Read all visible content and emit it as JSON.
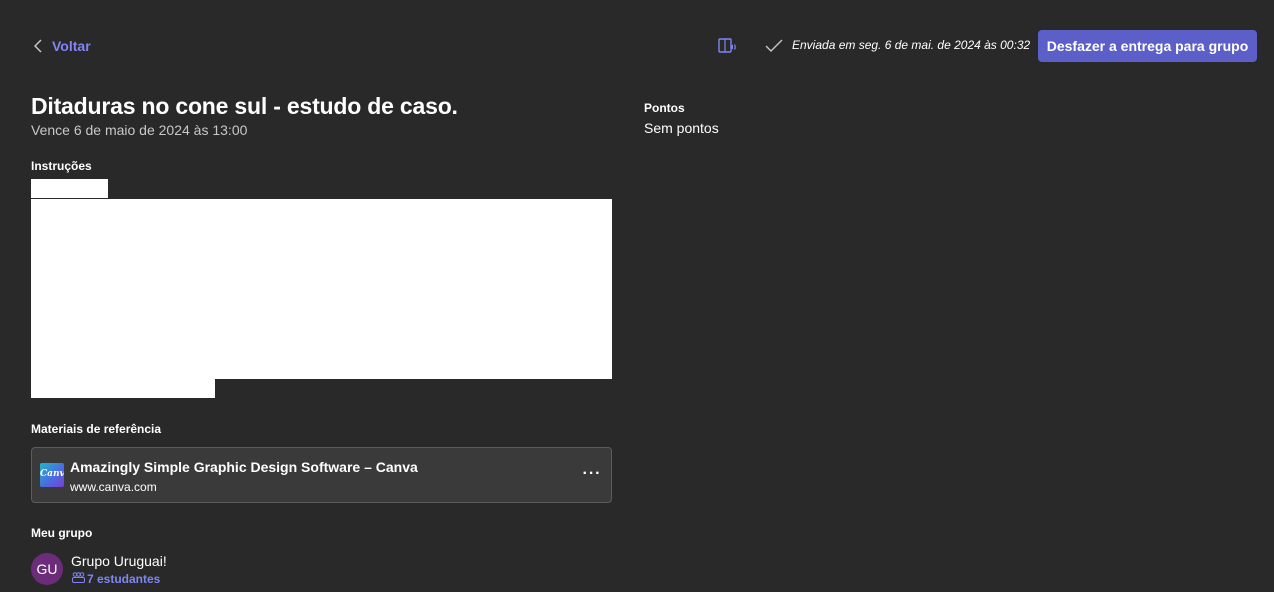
{
  "header": {
    "back_label": "Voltar",
    "sent_status": "Enviada em seg. 6 de mai. de 2024 às 00:32",
    "undo_button_label": "Desfazer a entrega para grupo",
    "icons": {
      "back": "chevron-left-icon",
      "reader": "immersive-reader-icon",
      "sent": "checkmark-icon"
    }
  },
  "assignment": {
    "title": "Ditaduras no cone sul - estudo de caso.",
    "due": "Vence 6 de maio de 2024 às 13:00"
  },
  "instructions": {
    "label": "Instruções"
  },
  "reference": {
    "label": "Materiais de referência",
    "items": [
      {
        "title": "Amazingly Simple Graphic Design Software – Canva",
        "url": "www.canva.com",
        "thumb_text": "Canva",
        "more_label": "···"
      }
    ]
  },
  "group": {
    "label": "Meu grupo",
    "avatar_initials": "GU",
    "name": "Grupo Uruguai!",
    "students": "7 estudantes"
  },
  "points": {
    "label": "Pontos",
    "value": "Sem pontos"
  },
  "colors": {
    "background": "#292929",
    "accent": "#7f85f5",
    "primary_button": "#5b5fc7",
    "avatar": "#6b2d7a",
    "card": "#3a3a3a"
  }
}
